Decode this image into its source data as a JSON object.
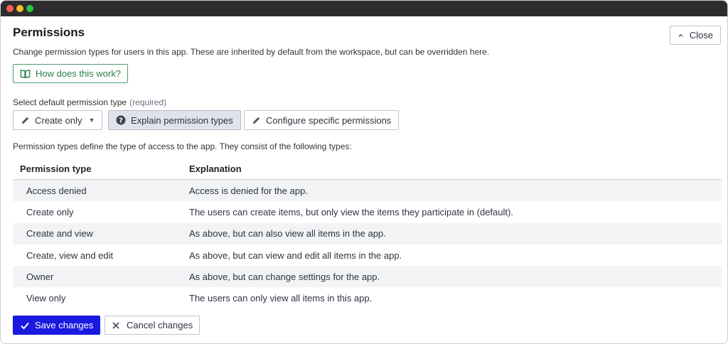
{
  "window": {
    "controls": [
      "close",
      "minimize",
      "maximize"
    ]
  },
  "header": {
    "title": "Permissions",
    "description": "Change permission types for users in this app. These are inherited by default from the workspace, but can be overridden here.",
    "close_label": "Close"
  },
  "help": {
    "how_label": "How does this work?"
  },
  "select": {
    "label": "Select default permission type",
    "required": "(required)",
    "selected_value": "Create only",
    "explain_label": "Explain permission types",
    "configure_label": "Configure specific permissions"
  },
  "types": {
    "description": "Permission types define the type of access to the app. They consist of the following types:",
    "headers": [
      "Permission type",
      "Explanation"
    ],
    "rows": [
      [
        "Access denied",
        "Access is denied for the app."
      ],
      [
        "Create only",
        "The users can create items, but only view the items they participate in (default)."
      ],
      [
        "Create and view",
        "As above, but can also view all items in the app."
      ],
      [
        "Create, view and edit",
        "As above, but can view and edit all items in the app."
      ],
      [
        "Owner",
        "As above, but can change settings for the app."
      ],
      [
        "View only",
        "The users can only view all items in this app."
      ]
    ]
  },
  "footer": {
    "save_label": "Save changes",
    "cancel_label": "Cancel changes"
  },
  "colors": {
    "primary": "#1919e0",
    "help_green": "#2e7d4f",
    "row_stripe": "#f1f3f5"
  }
}
